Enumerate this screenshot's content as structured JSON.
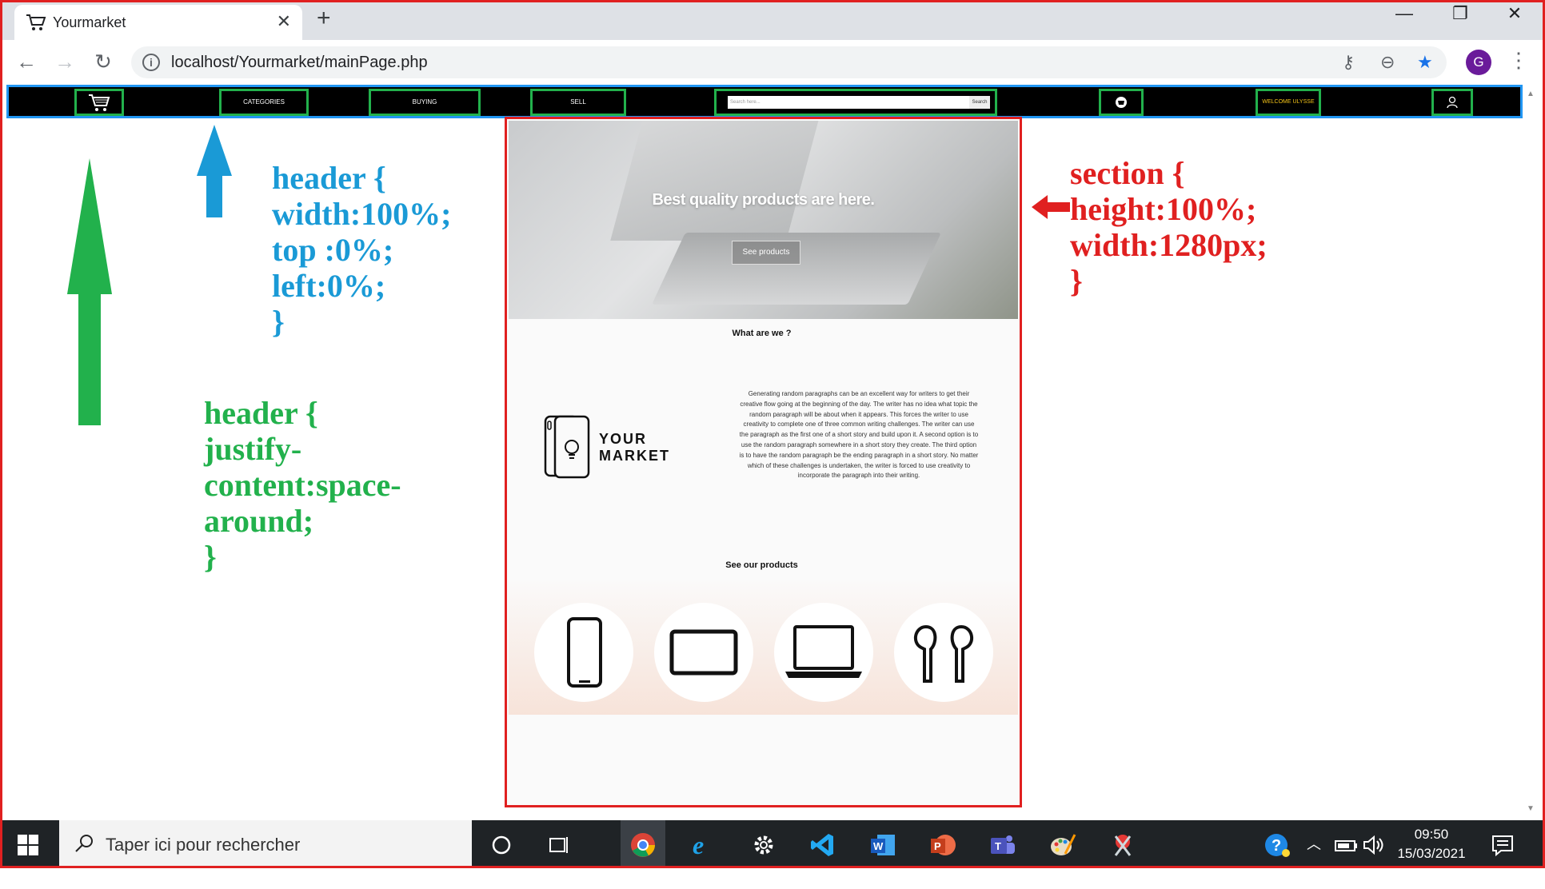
{
  "browser": {
    "tab_title": "Yourmarket",
    "url": "localhost/Yourmarket/mainPage.php",
    "profile_initial": "G"
  },
  "site": {
    "nav": {
      "categories": "CATEGORIES",
      "buying": "BUYING",
      "sell": "SELL",
      "search_placeholder": "Search here...",
      "search_button": "Search",
      "welcome": "WELCOME ULYSSE"
    },
    "hero": {
      "title": "Best quality products are here.",
      "button": "See products"
    },
    "about": {
      "title": "What are we ?",
      "logo_line1": "YOUR",
      "logo_line2": "MARKET",
      "paragraph": "Generating random paragraphs can be an excellent way for writers to get their creative flow going at the beginning of the day. The writer has no idea what topic the random paragraph will be about when it appears. This forces the writer to use creativity to complete one of three common writing challenges. The writer can use the paragraph as the first one of a short story and build upon it. A second option is to use the random paragraph somewhere in a short story they create. The third option is to have the random paragraph be the ending paragraph in a short story. No matter which of these challenges is undertaken, the writer is forced to use creativity to incorporate the paragraph into their writing."
    },
    "products": {
      "title": "See our products",
      "items": [
        "phone-icon",
        "tablet-icon",
        "laptop-icon",
        "earbuds-icon"
      ]
    }
  },
  "annotations": {
    "blue": "header {\nwidth:100%;\ntop :0%;\nleft:0%;\n}",
    "green": "header {\njustify-\ncontent:space-\naround;\n}",
    "red": "section {\nheight:100%;\nwidth:1280px;\n}"
  },
  "taskbar": {
    "search_text": "Taper ici pour rechercher",
    "time": "09:50",
    "date": "15/03/2021"
  },
  "colors": {
    "header_bg": "#000000",
    "header_border": "#2196f3",
    "nav_item_border": "#22b14c",
    "section_border": "#e02020",
    "welcome_text": "#f5c518"
  }
}
